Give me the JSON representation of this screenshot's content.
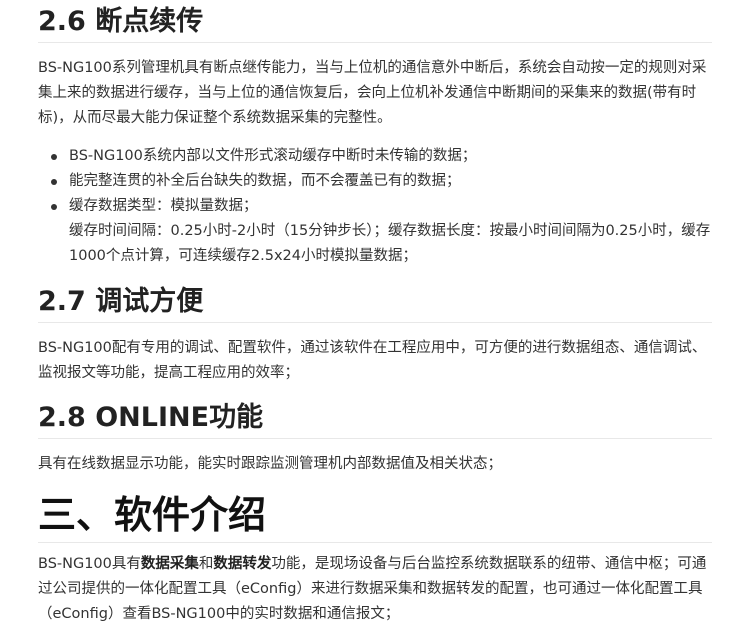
{
  "sec26": {
    "title": "2.6 断点续传",
    "para": "BS-NG100系列管理机具有断点继传能力，当与上位机的通信意外中断后，系统会自动按一定的规则对采集上来的数据进行缓存，当与上位的通信恢复后，会向上位机补发通信中断期间的采集来的数据(带有时标)，从而尽最大能力保证整个系统数据采集的完整性。",
    "bullets": [
      "BS-NG100系统内部以文件形式滚动缓存中断时未传输的数据；",
      "能完整连贯的补全后台缺失的数据，而不会覆盖已有的数据；",
      "缓存数据类型：模拟量数据；"
    ],
    "bullet3_detail": "缓存时间间隔：0.25小时-2小时（15分钟步长）；缓存数据长度：按最小时间间隔为0.25小时，缓存1000个点计算，可连续缓存2.5x24小时模拟量数据；"
  },
  "sec27": {
    "title": "2.7 调试方便",
    "para": "BS-NG100配有专用的调试、配置软件，通过该软件在工程应用中，可方便的进行数据组态、通信调试、监视报文等功能，提高工程应用的效率；"
  },
  "sec28": {
    "title": "2.8 ONLINE功能",
    "para": "具有在线数据显示功能，能实时跟踪监测管理机内部数据值及相关状态；"
  },
  "sec3": {
    "title": "三、软件介绍",
    "para_start": "BS-NG100具有",
    "bold1": "数据采集",
    "and": "和",
    "bold2": "数据转发",
    "para_rest": "功能，是现场设备与后台监控系统数据联系的纽带、通信中枢；可通过公司提供的一体化配置工具（eConfig）来进行数据采集和数据转发的配置，也可通过一体化配置工具（eConfig）查看BS-NG100中的实时数据和通信报文；"
  }
}
